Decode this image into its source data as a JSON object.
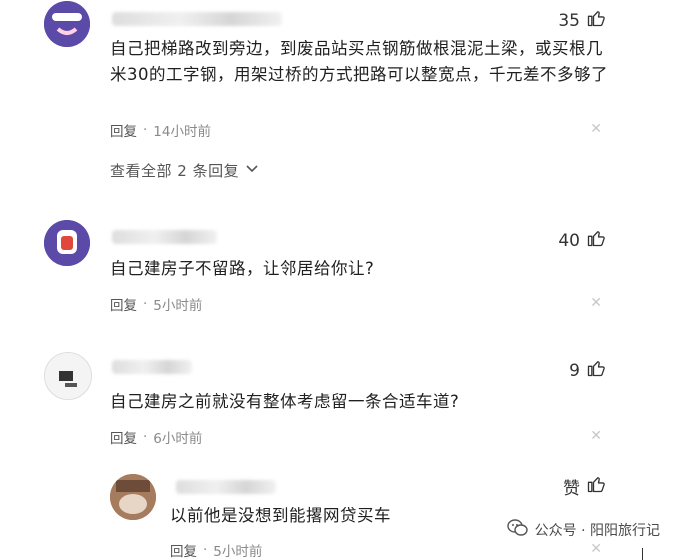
{
  "comments": [
    {
      "likes": "35",
      "text": "自己把梯路改到旁边，到废品站买点钢筋做根混泥土梁，或买根几米30的工字钢，用架过桥的方式把路可以整宽点，千元差不多够了",
      "reply_label": "回复",
      "time": "14小时前",
      "view_more": "查看全部 2 条回复"
    },
    {
      "likes": "40",
      "text": "自己建房子不留路，让邻居给你让?",
      "reply_label": "回复",
      "time": "5小时前"
    },
    {
      "likes": "9",
      "text": "自己建房之前就没有整体考虑留一条合适车道?",
      "reply_label": "回复",
      "time": "6小时前"
    }
  ],
  "sub_reply": {
    "likes": "赞",
    "text": "以前他是没想到能撂网贷买车",
    "reply_label": "回复",
    "time": "5小时前"
  },
  "watermark": {
    "text": "公众号 · 阳阳旅行记"
  },
  "separator": "·",
  "colors": {
    "text": "#1f1f1f",
    "meta": "#8a8a8a",
    "avatar1": "#6a55b4",
    "avatar2": "#5b4aa8"
  }
}
